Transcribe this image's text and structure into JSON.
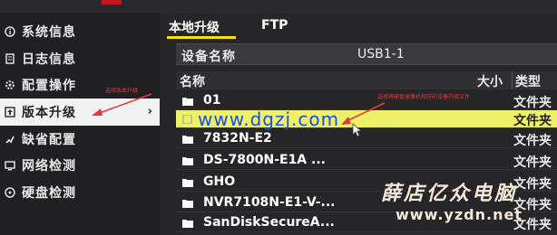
{
  "sidebar": {
    "items": [
      {
        "label": "系统信息",
        "icon": "info-icon"
      },
      {
        "label": "日志信息",
        "icon": "log-icon"
      },
      {
        "label": "配置操作",
        "icon": "config-icon"
      },
      {
        "label": "版本升级",
        "icon": "upgrade-icon",
        "active": true,
        "arrow": "›"
      },
      {
        "label": "缺省配置",
        "icon": "default-config-icon"
      },
      {
        "label": "网络检测",
        "icon": "network-icon"
      },
      {
        "label": "硬盘检测",
        "icon": "disk-icon"
      }
    ]
  },
  "annotations": {
    "left": "选择版本升级",
    "right": "选择将硬盘录像机相符的设备升级文件"
  },
  "tabs": [
    {
      "label": "本地升级",
      "active": true
    },
    {
      "label": "FTP"
    }
  ],
  "device": {
    "label": "设备名称",
    "value": "USB1-1"
  },
  "table": {
    "columns": {
      "name": "名称",
      "size": "大小",
      "type": "类型"
    },
    "rows": [
      {
        "name": "01",
        "type": "文件夹",
        "icon": "folder-icon"
      },
      {
        "name": "",
        "type": "文件夹",
        "icon": "file-icon",
        "selected": true
      },
      {
        "name": "7832N-E2",
        "type": "文件夹",
        "icon": "folder-icon"
      },
      {
        "name": "DS-7800N-E1A ...",
        "type": "文件夹",
        "icon": "folder-icon"
      },
      {
        "name": "GHO",
        "type": "文件夹",
        "icon": "folder-icon"
      },
      {
        "name": "NVR7108N-E1-V-...",
        "type": "文件夹",
        "icon": "folder-icon"
      },
      {
        "name": "SanDiskSecureA...",
        "type": "文件夹",
        "icon": "folder-icon"
      }
    ]
  },
  "watermarks": {
    "url": "www.dgzj.com",
    "brand": "薛店亿众电脑",
    "brand_url": "www.yzdn.net"
  },
  "colors": {
    "accent": "#f5e21a",
    "selected_row": "#eef06a",
    "annotation": "#e23a3a",
    "header_red": "#c4161c"
  }
}
